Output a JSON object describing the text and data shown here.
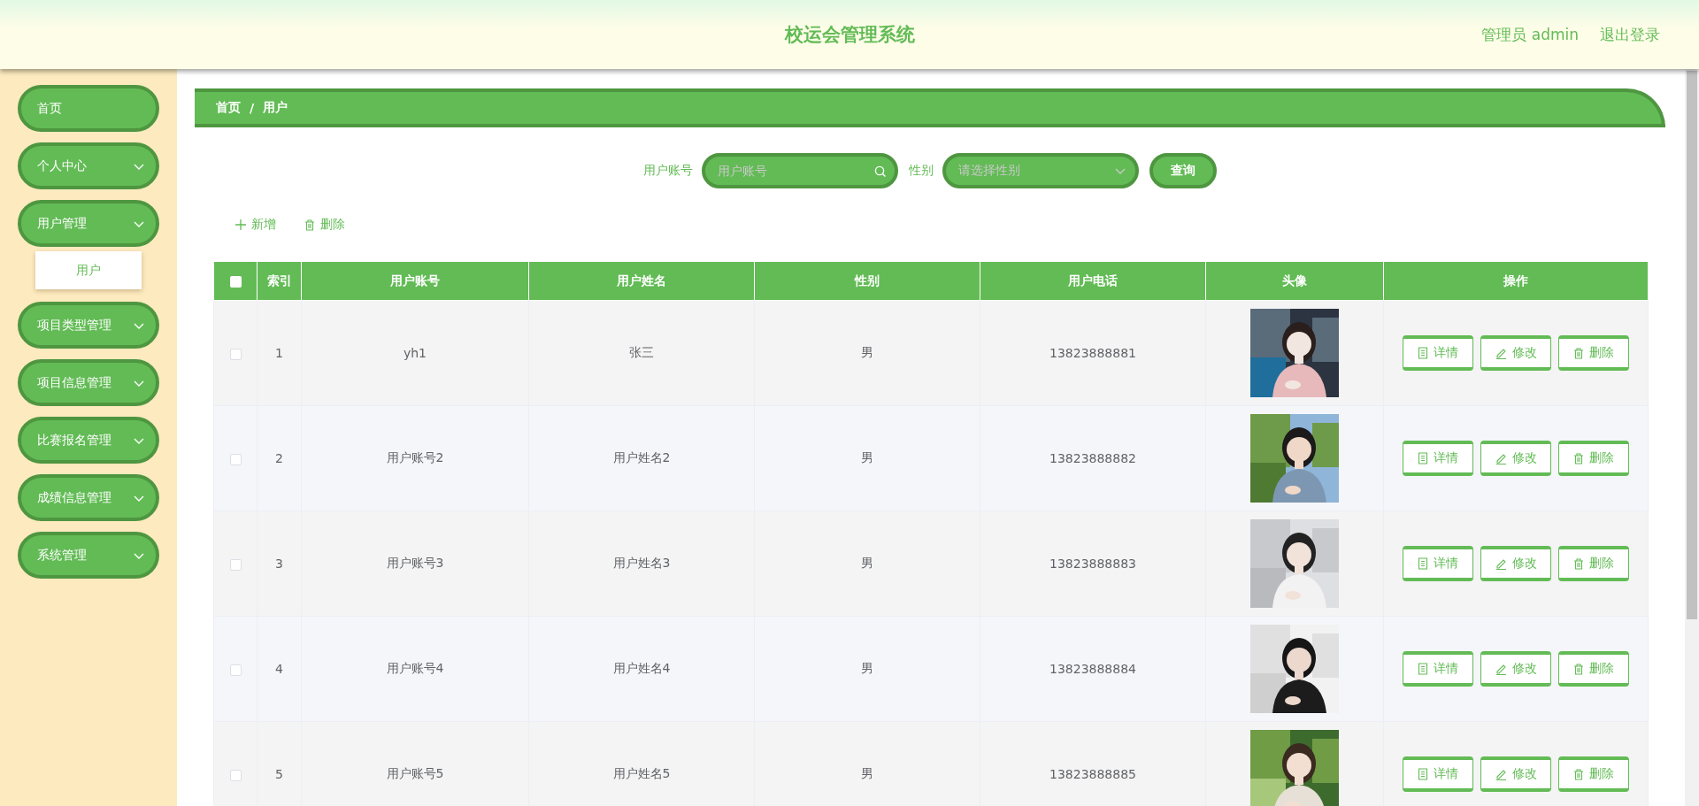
{
  "header": {
    "title": "校运会管理系统",
    "user_label": "管理员 admin",
    "logout": "退出登录"
  },
  "sidebar": {
    "items": [
      {
        "label": "首页",
        "kind": "link"
      },
      {
        "label": "个人中心",
        "kind": "menu"
      },
      {
        "label": "用户管理",
        "kind": "menu",
        "expanded": true,
        "children": [
          {
            "label": "用户",
            "selected": true
          }
        ]
      },
      {
        "label": "项目类型管理",
        "kind": "menu"
      },
      {
        "label": "项目信息管理",
        "kind": "menu"
      },
      {
        "label": "比赛报名管理",
        "kind": "menu"
      },
      {
        "label": "成绩信息管理",
        "kind": "menu"
      },
      {
        "label": "系统管理",
        "kind": "menu"
      }
    ]
  },
  "breadcrumb": {
    "items": [
      "首页",
      "用户"
    ],
    "separator": "/"
  },
  "search": {
    "fields": [
      {
        "kind": "input",
        "label": "用户账号",
        "placeholder": "用户账号"
      },
      {
        "kind": "select",
        "label": "性别",
        "placeholder": "请选择性别"
      }
    ],
    "button": "查询"
  },
  "actions": [
    {
      "kind": "add",
      "label": "新增"
    },
    {
      "kind": "delete",
      "label": "删除"
    }
  ],
  "table": {
    "select_all_checked": false,
    "columns": [
      "索引",
      "用户账号",
      "用户姓名",
      "性别",
      "用户电话",
      "头像",
      "操作"
    ],
    "rows": [
      {
        "checked": false,
        "cells": [
          "1",
          "yh1",
          "张三",
          "男",
          "13823888881"
        ],
        "buttons": [
          {
            "kind": "detail",
            "label": "详情"
          },
          {
            "kind": "edit",
            "label": "修改"
          },
          {
            "kind": "delete",
            "label": "删除"
          }
        ]
      },
      {
        "checked": false,
        "cells": [
          "2",
          "用户账号2",
          "用户姓名2",
          "男",
          "13823888882"
        ],
        "buttons": [
          {
            "kind": "detail",
            "label": "详情"
          },
          {
            "kind": "edit",
            "label": "修改"
          },
          {
            "kind": "delete",
            "label": "删除"
          }
        ]
      },
      {
        "checked": false,
        "cells": [
          "3",
          "用户账号3",
          "用户姓名3",
          "男",
          "13823888883"
        ],
        "buttons": [
          {
            "kind": "detail",
            "label": "详情"
          },
          {
            "kind": "edit",
            "label": "修改"
          },
          {
            "kind": "delete",
            "label": "删除"
          }
        ]
      },
      {
        "checked": false,
        "cells": [
          "4",
          "用户账号4",
          "用户姓名4",
          "男",
          "13823888884"
        ],
        "buttons": [
          {
            "kind": "detail",
            "label": "详情"
          },
          {
            "kind": "edit",
            "label": "修改"
          },
          {
            "kind": "delete",
            "label": "删除"
          }
        ]
      },
      {
        "checked": false,
        "cells": [
          "5",
          "用户账号5",
          "用户姓名5",
          "男",
          "13823888885"
        ],
        "buttons": [
          {
            "kind": "detail",
            "label": "详情"
          },
          {
            "kind": "edit",
            "label": "修改"
          },
          {
            "kind": "delete",
            "label": "删除"
          }
        ]
      }
    ]
  }
}
